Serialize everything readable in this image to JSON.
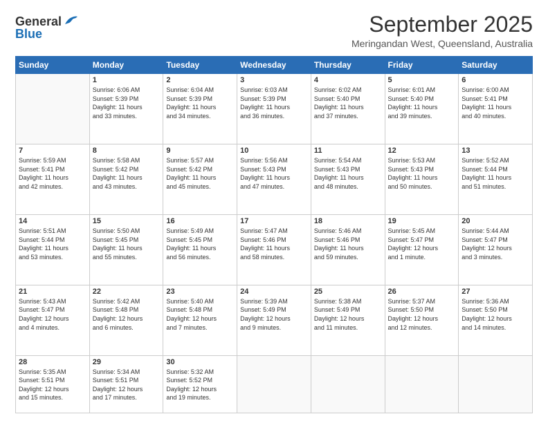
{
  "logo": {
    "line1": "General",
    "line2": "Blue"
  },
  "title": "September 2025",
  "subtitle": "Meringandan West, Queensland, Australia",
  "days_header": [
    "Sunday",
    "Monday",
    "Tuesday",
    "Wednesday",
    "Thursday",
    "Friday",
    "Saturday"
  ],
  "weeks": [
    [
      {
        "num": "",
        "info": ""
      },
      {
        "num": "1",
        "info": "Sunrise: 6:06 AM\nSunset: 5:39 PM\nDaylight: 11 hours\nand 33 minutes."
      },
      {
        "num": "2",
        "info": "Sunrise: 6:04 AM\nSunset: 5:39 PM\nDaylight: 11 hours\nand 34 minutes."
      },
      {
        "num": "3",
        "info": "Sunrise: 6:03 AM\nSunset: 5:39 PM\nDaylight: 11 hours\nand 36 minutes."
      },
      {
        "num": "4",
        "info": "Sunrise: 6:02 AM\nSunset: 5:40 PM\nDaylight: 11 hours\nand 37 minutes."
      },
      {
        "num": "5",
        "info": "Sunrise: 6:01 AM\nSunset: 5:40 PM\nDaylight: 11 hours\nand 39 minutes."
      },
      {
        "num": "6",
        "info": "Sunrise: 6:00 AM\nSunset: 5:41 PM\nDaylight: 11 hours\nand 40 minutes."
      }
    ],
    [
      {
        "num": "7",
        "info": "Sunrise: 5:59 AM\nSunset: 5:41 PM\nDaylight: 11 hours\nand 42 minutes."
      },
      {
        "num": "8",
        "info": "Sunrise: 5:58 AM\nSunset: 5:42 PM\nDaylight: 11 hours\nand 43 minutes."
      },
      {
        "num": "9",
        "info": "Sunrise: 5:57 AM\nSunset: 5:42 PM\nDaylight: 11 hours\nand 45 minutes."
      },
      {
        "num": "10",
        "info": "Sunrise: 5:56 AM\nSunset: 5:43 PM\nDaylight: 11 hours\nand 47 minutes."
      },
      {
        "num": "11",
        "info": "Sunrise: 5:54 AM\nSunset: 5:43 PM\nDaylight: 11 hours\nand 48 minutes."
      },
      {
        "num": "12",
        "info": "Sunrise: 5:53 AM\nSunset: 5:43 PM\nDaylight: 11 hours\nand 50 minutes."
      },
      {
        "num": "13",
        "info": "Sunrise: 5:52 AM\nSunset: 5:44 PM\nDaylight: 11 hours\nand 51 minutes."
      }
    ],
    [
      {
        "num": "14",
        "info": "Sunrise: 5:51 AM\nSunset: 5:44 PM\nDaylight: 11 hours\nand 53 minutes."
      },
      {
        "num": "15",
        "info": "Sunrise: 5:50 AM\nSunset: 5:45 PM\nDaylight: 11 hours\nand 55 minutes."
      },
      {
        "num": "16",
        "info": "Sunrise: 5:49 AM\nSunset: 5:45 PM\nDaylight: 11 hours\nand 56 minutes."
      },
      {
        "num": "17",
        "info": "Sunrise: 5:47 AM\nSunset: 5:46 PM\nDaylight: 11 hours\nand 58 minutes."
      },
      {
        "num": "18",
        "info": "Sunrise: 5:46 AM\nSunset: 5:46 PM\nDaylight: 11 hours\nand 59 minutes."
      },
      {
        "num": "19",
        "info": "Sunrise: 5:45 AM\nSunset: 5:47 PM\nDaylight: 12 hours\nand 1 minute."
      },
      {
        "num": "20",
        "info": "Sunrise: 5:44 AM\nSunset: 5:47 PM\nDaylight: 12 hours\nand 3 minutes."
      }
    ],
    [
      {
        "num": "21",
        "info": "Sunrise: 5:43 AM\nSunset: 5:47 PM\nDaylight: 12 hours\nand 4 minutes."
      },
      {
        "num": "22",
        "info": "Sunrise: 5:42 AM\nSunset: 5:48 PM\nDaylight: 12 hours\nand 6 minutes."
      },
      {
        "num": "23",
        "info": "Sunrise: 5:40 AM\nSunset: 5:48 PM\nDaylight: 12 hours\nand 7 minutes."
      },
      {
        "num": "24",
        "info": "Sunrise: 5:39 AM\nSunset: 5:49 PM\nDaylight: 12 hours\nand 9 minutes."
      },
      {
        "num": "25",
        "info": "Sunrise: 5:38 AM\nSunset: 5:49 PM\nDaylight: 12 hours\nand 11 minutes."
      },
      {
        "num": "26",
        "info": "Sunrise: 5:37 AM\nSunset: 5:50 PM\nDaylight: 12 hours\nand 12 minutes."
      },
      {
        "num": "27",
        "info": "Sunrise: 5:36 AM\nSunset: 5:50 PM\nDaylight: 12 hours\nand 14 minutes."
      }
    ],
    [
      {
        "num": "28",
        "info": "Sunrise: 5:35 AM\nSunset: 5:51 PM\nDaylight: 12 hours\nand 15 minutes."
      },
      {
        "num": "29",
        "info": "Sunrise: 5:34 AM\nSunset: 5:51 PM\nDaylight: 12 hours\nand 17 minutes."
      },
      {
        "num": "30",
        "info": "Sunrise: 5:32 AM\nSunset: 5:52 PM\nDaylight: 12 hours\nand 19 minutes."
      },
      {
        "num": "",
        "info": ""
      },
      {
        "num": "",
        "info": ""
      },
      {
        "num": "",
        "info": ""
      },
      {
        "num": "",
        "info": ""
      }
    ]
  ]
}
